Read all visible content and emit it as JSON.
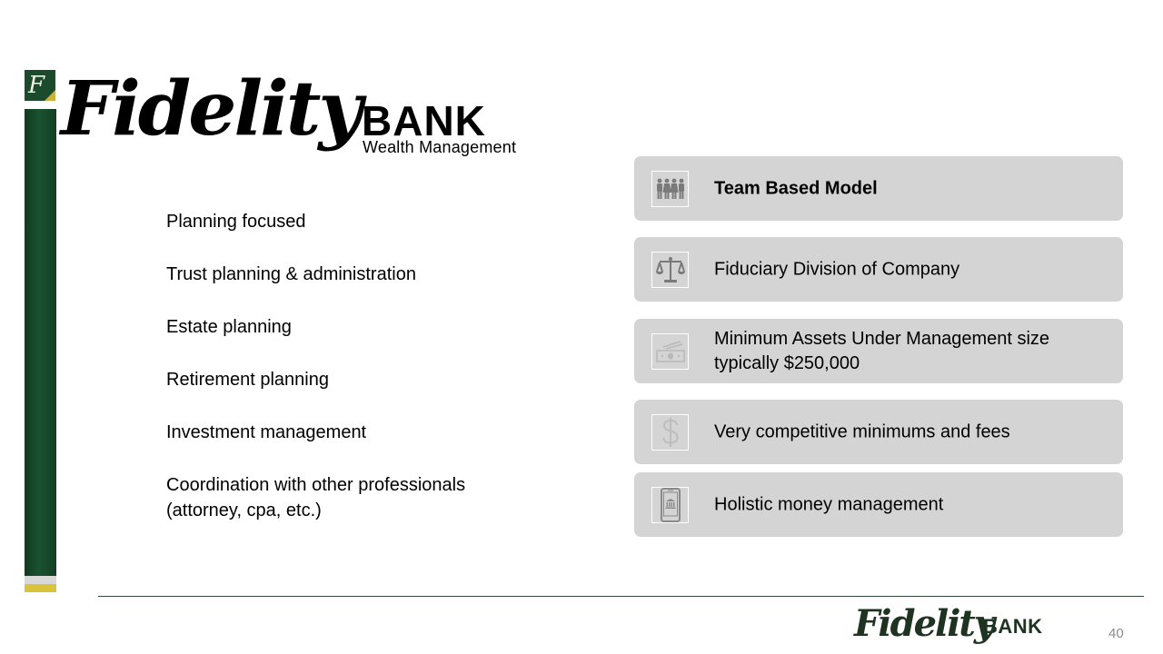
{
  "brand": {
    "monogram": "F",
    "script_name": "Fidelity",
    "bank_word": "BANK",
    "division": "Wealth Management",
    "colors": {
      "green": "#1c4a2c",
      "gold": "#d9c33a",
      "grey_stripe": "#d9d9d9",
      "card_bg": "#d4d4d4"
    }
  },
  "services": [
    {
      "text": "Planning focused"
    },
    {
      "text": "Trust planning & administration"
    },
    {
      "text": "Estate planning"
    },
    {
      "text": "Retirement planning"
    },
    {
      "text": "Investment management"
    },
    {
      "text": "Coordination with other professionals (attorney, cpa, etc.)"
    }
  ],
  "features": [
    {
      "icon": "team-icon",
      "text": "Team Based Model",
      "bold": true
    },
    {
      "icon": "scales-icon",
      "text": "Fiduciary Division of Company",
      "bold": false
    },
    {
      "icon": "money-icon",
      "text": "Minimum Assets Under Management size typically $250,000",
      "bold": false
    },
    {
      "icon": "dollar-icon",
      "text": "Very competitive minimums and fees",
      "bold": false
    },
    {
      "icon": "mobile-bank-icon",
      "text": "Holistic money management",
      "bold": false
    }
  ],
  "footer": {
    "script_name": "Fidelity",
    "bank_word": "BANK",
    "page_number": "40"
  }
}
